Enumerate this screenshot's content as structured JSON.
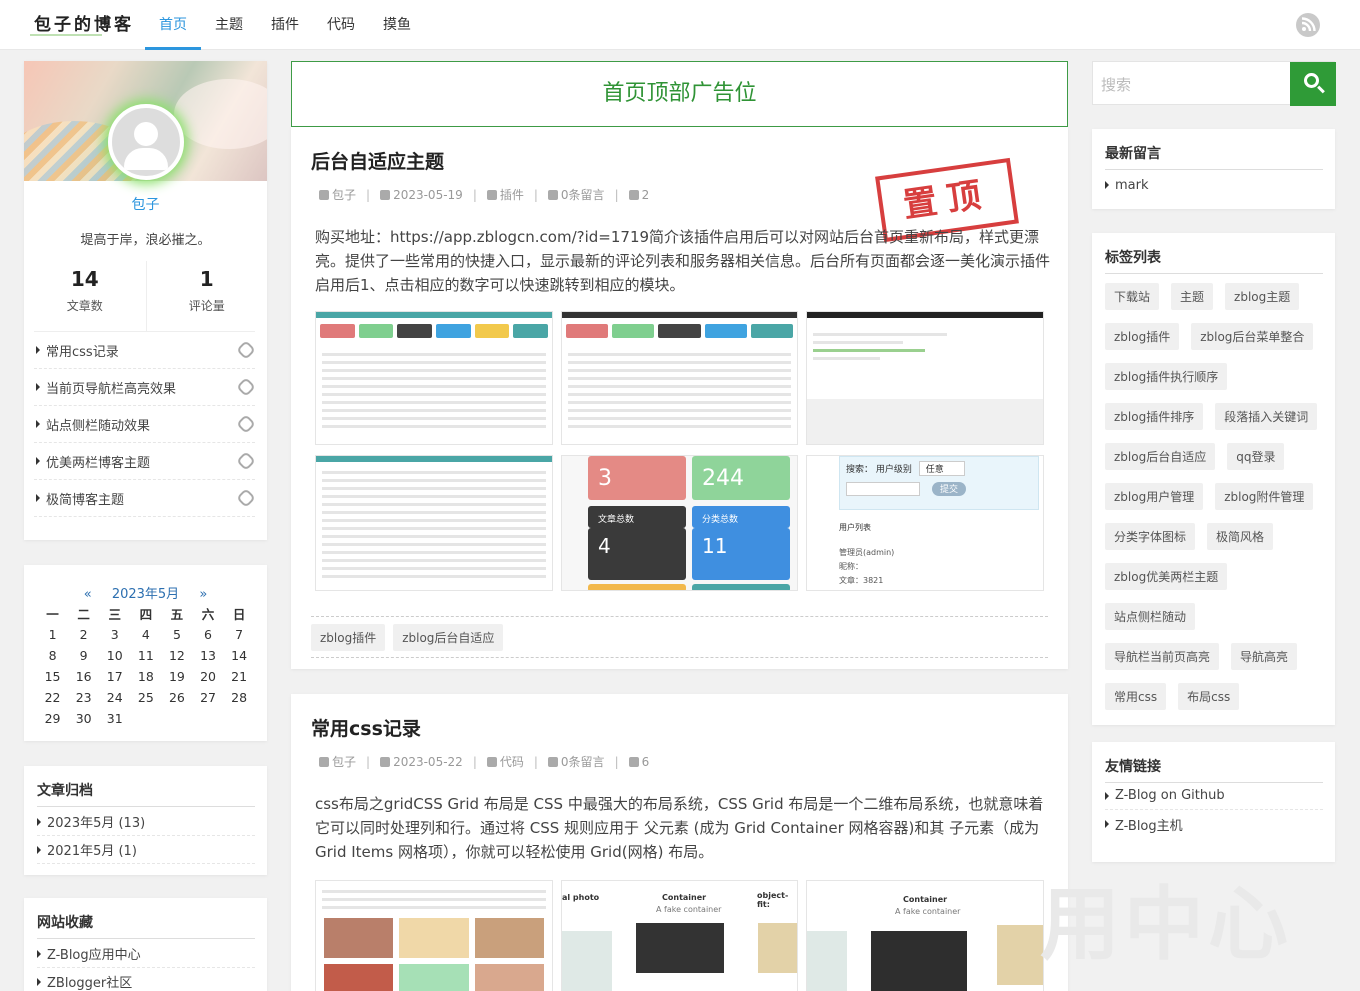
{
  "header": {
    "logo_text": "包子的博客",
    "nav": [
      {
        "label": "首页",
        "active": true
      },
      {
        "label": "主题",
        "active": false
      },
      {
        "label": "插件",
        "active": false
      },
      {
        "label": "代码",
        "active": false
      },
      {
        "label": "摸鱼",
        "active": false
      }
    ],
    "rss_icon": "rss-icon"
  },
  "profile": {
    "name": "包子",
    "motto": "堤高于岸，浪必摧之。",
    "posts_count": "14",
    "posts_label": "文章数",
    "comments_count": "1",
    "comments_label": "评论量",
    "links": [
      "常用css记录",
      "当前页导航栏高亮效果",
      "站点侧栏随动效果",
      "优美两栏博客主题",
      "极简博客主题"
    ]
  },
  "calendar": {
    "prev": "«",
    "title": "2023年5月",
    "next": "»",
    "weekdays": [
      "一",
      "二",
      "三",
      "四",
      "五",
      "六",
      "日"
    ],
    "weeks": [
      [
        "1",
        "2",
        "3",
        "4",
        "5",
        "6",
        "7"
      ],
      [
        "8",
        "9",
        "10",
        "11",
        "12",
        "13",
        "14"
      ],
      [
        "15",
        "16",
        "17",
        "18",
        "19",
        "20",
        "21"
      ],
      [
        "22",
        "23",
        "24",
        "25",
        "26",
        "27",
        "28"
      ],
      [
        "29",
        "30",
        "31",
        "",
        "",
        "",
        ""
      ]
    ]
  },
  "archive": {
    "title": "文章归档",
    "items": [
      "2023年5月 (13)",
      "2021年5月 (1)"
    ]
  },
  "favorites": {
    "title": "网站收藏",
    "items": [
      "Z-Blog应用中心",
      "ZBlogger社区"
    ]
  },
  "ad": {
    "text": "首页顶部广告位"
  },
  "posts": [
    {
      "title": "后台自适应主题",
      "author": "包子",
      "date": "2023-05-19",
      "category": "插件",
      "comments": "0条留言",
      "views": "2",
      "stamp": "置顶",
      "excerpt": "购买地址：https://app.zblogcn.com/?id=1719简介该插件启用后可以对网站后台首页重新布局，样式更漂亮。提供了一些常用的快捷入口，显示最新的评论列表和服务器相关信息。后台所有页面都会逐一美化演示插件启用后1、点击相应的数字可以快速跳转到相应的模块。",
      "thumb_tiles": [
        "3",
        "244",
        "文章总数",
        "4",
        "分类总数",
        "11",
        "搜索：",
        "用户级别",
        "任意",
        "提交",
        "用户列表",
        "管理员(admin)",
        "昵称：",
        "文章：",
        "3821"
      ],
      "tags": [
        "zblog插件",
        "zblog后台自适应"
      ]
    },
    {
      "title": "常用css记录",
      "author": "包子",
      "date": "2023-05-22",
      "category": "代码",
      "comments": "0条留言",
      "views": "6",
      "excerpt": "css布局之gridCSS Grid 布局是 CSS 中最强大的布局系统，CSS Grid 布局是一个二维布局系统，也就意味着它可以同时处理列和行。通过将 CSS 规则应用于 父元素 (成为 Grid Container 网格容器)和其 子元素（成为 Grid Items 网格项），你就可以轻松使用 Grid(网格) 布局。",
      "thumb_labels": [
        "al photo",
        "Container",
        "A fake container",
        "object-fit:",
        "Container",
        "A fake container"
      ]
    }
  ],
  "search": {
    "placeholder": "搜索"
  },
  "recent_comments": {
    "title": "最新留言",
    "items": [
      "mark"
    ]
  },
  "tag_list": {
    "title": "标签列表",
    "rows": [
      [
        "下载站",
        "主题",
        "zblog主题"
      ],
      [
        "zblog插件",
        "zblog后台菜单整合"
      ],
      [
        "zblog插件执行顺序"
      ],
      [
        "zblog插件排序",
        "段落插入关键词"
      ],
      [
        "zblog后台自适应",
        "qq登录"
      ],
      [
        "zblog用户管理",
        "zblog附件管理"
      ],
      [
        "分类字体图标",
        "极简风格"
      ],
      [
        "zblog优美两栏主题"
      ],
      [
        "站点侧栏随动"
      ],
      [
        "导航栏当前页高亮",
        "导航高亮"
      ],
      [
        "常用css",
        "布局css"
      ]
    ]
  },
  "friend_links": {
    "title": "友情链接",
    "items": [
      "Z-Blog on Github",
      "Z-Blog主机"
    ]
  },
  "watermark": "用中心",
  "colors": {
    "accent": "#2c96de",
    "green": "#2f9b37",
    "stamp": "#d32a2a"
  }
}
